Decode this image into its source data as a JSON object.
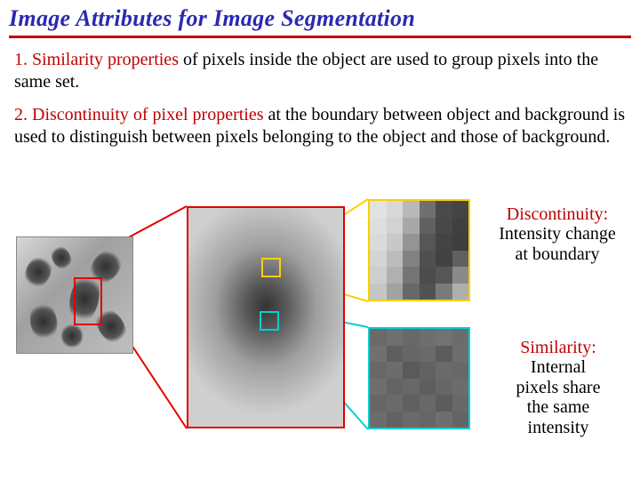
{
  "title": "Image Attributes for Image Segmentation",
  "para1_lead": "1. Similarity properties",
  "para1_rest": " of pixels inside the object are used to group pixels into the same set.",
  "para2_lead": "2. Discontinuity of pixel properties",
  "para2_rest": " at the boundary between object and background is used to distinguish between pixels belonging to the object and those of background.",
  "disc_label_head": "Discontinuity:",
  "disc_label_body_l1": "Intensity change",
  "disc_label_body_l2": "at boundary",
  "sim_label_head": "Similarity:",
  "sim_label_body_l1": "Internal",
  "sim_label_body_l2": "pixels share",
  "sim_label_body_l3": "the same",
  "sim_label_body_l4": "intensity",
  "colors": {
    "title": "#2a2ab0",
    "underline": "#c00000",
    "red": "#e00000",
    "yellow": "#f7d100",
    "cyan": "#00d0d0"
  }
}
